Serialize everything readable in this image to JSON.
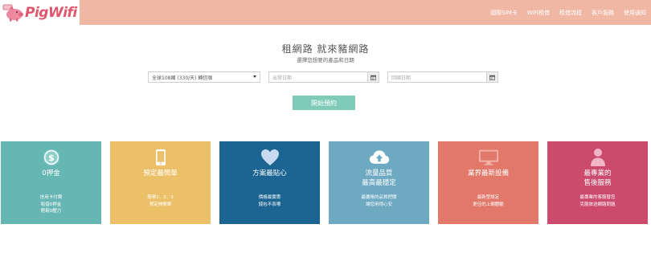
{
  "header": {
    "logo_text": "PigWifi",
    "nav": [
      "國際SIM卡",
      "WiFi租借",
      "租借流程",
      "客戶服務",
      "使用通知"
    ]
  },
  "hero": {
    "title": "租網路 就來豬網路",
    "subtitle": "選擇您想要的產品和日期"
  },
  "booking": {
    "product_select": "全球108國 (330/天) 轉信咖",
    "depart_placeholder": "出發日期",
    "return_placeholder": "回國日期",
    "submit_label": "開始預約"
  },
  "features": [
    {
      "icon": "dollar-icon",
      "color": "#66b6b3",
      "title": [
        "0押金"
      ],
      "desc": [
        "信用卡付費",
        "租借0押金",
        "輕鬆0壓力"
      ]
    },
    {
      "icon": "phone-icon",
      "color": "#ecc069",
      "title": [
        "預定最簡單"
      ],
      "desc": [
        "簡單1．2．3",
        "預定神簡單"
      ]
    },
    {
      "icon": "heart-icon",
      "color": "#1c6592",
      "title": [
        "方案最貼心"
      ],
      "desc": [
        "價格最實惠",
        "錢包不哀嚎"
      ]
    },
    {
      "icon": "cloud-upload-icon",
      "color": "#6ea9c2",
      "title": [
        "流量品質",
        "最高最穩定"
      ],
      "desc": [
        "最嚴格的品質把關",
        "讓您用得心安"
      ]
    },
    {
      "icon": "monitor-icon",
      "color": "#e1786a",
      "title": [
        "業界最新設備"
      ],
      "desc": [
        "最新型設定",
        "更佳的上網體驗"
      ]
    },
    {
      "icon": "person-icon",
      "color": "#cc4a6c",
      "title": [
        "最專業的",
        "售後服務"
      ],
      "desc": [
        "最專業的客服替您",
        "克服旅途網路問題"
      ]
    }
  ]
}
